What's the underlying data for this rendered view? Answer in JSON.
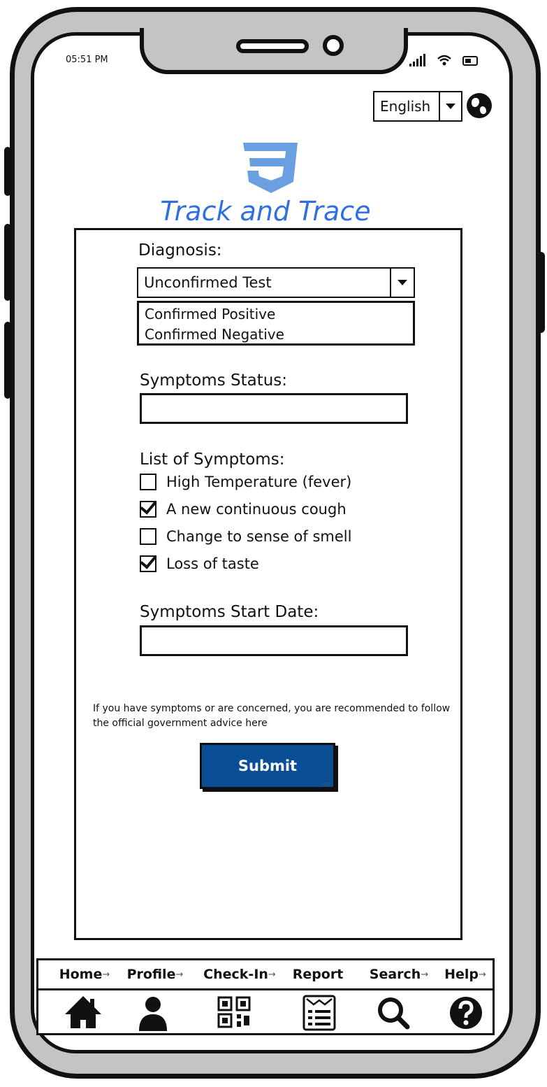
{
  "status_bar": {
    "time": "05:51 PM"
  },
  "language": {
    "selected": "English"
  },
  "app": {
    "title": "Track and Trace"
  },
  "form": {
    "diagnosis": {
      "label": "Diagnosis:",
      "selected": "Unconfirmed Test",
      "options": [
        "Confirmed Positive",
        "Confirmed Negative"
      ]
    },
    "symptoms_status": {
      "label": "Symptoms Status:",
      "value": ""
    },
    "symptoms_list": {
      "label": "List of Symptoms:",
      "items": [
        {
          "label": "High Temperature (fever)",
          "checked": false
        },
        {
          "label": "A new continuous cough",
          "checked": true
        },
        {
          "label": "Change to sense of smell",
          "checked": false
        },
        {
          "label": "Loss of taste",
          "checked": true
        }
      ]
    },
    "start_date": {
      "label": "Symptoms Start Date:",
      "value": ""
    },
    "advice": "If you have symptoms or are concerned, you are recommended to follow the official government advice here",
    "submit_label": "Submit"
  },
  "nav": {
    "items": [
      {
        "label": "Home",
        "icon": "home-icon"
      },
      {
        "label": "Profile",
        "icon": "profile-icon"
      },
      {
        "label": "Check-In",
        "icon": "qr-code-icon"
      },
      {
        "label": "Report",
        "icon": "report-icon"
      },
      {
        "label": "Search",
        "icon": "search-icon"
      },
      {
        "label": "Help",
        "icon": "help-icon"
      }
    ]
  },
  "colors": {
    "accent": "#0a4f96",
    "title": "#2f6fe0",
    "logo": "#6a9fe0",
    "frame": "#c4c4c4"
  }
}
